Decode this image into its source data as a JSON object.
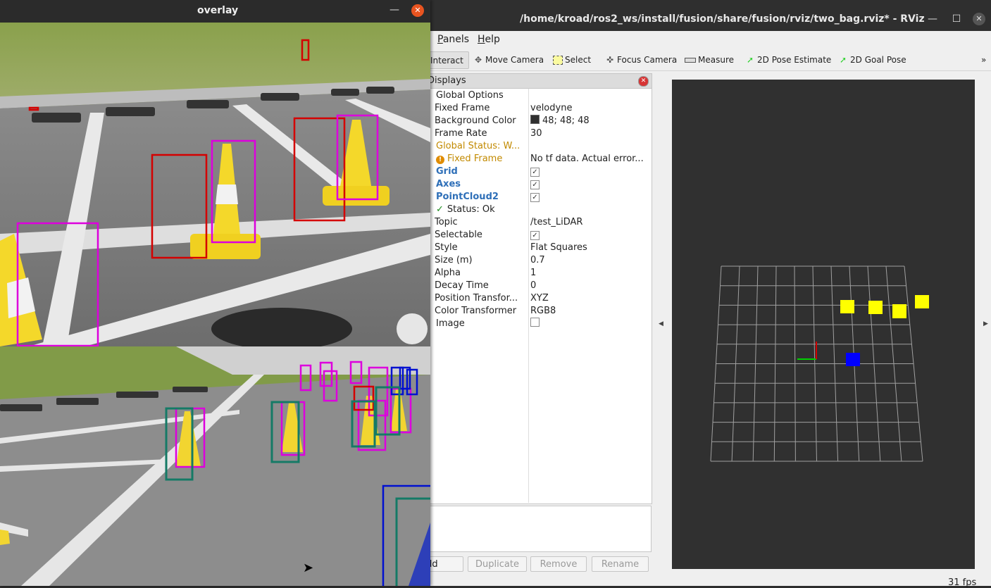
{
  "rviz": {
    "title": "/home/kroad/ros2_ws/install/fusion/share/fusion/rviz/two_bag.rviz* - RViz",
    "menu": [
      "Panels",
      "Help"
    ],
    "toolbar": {
      "interact": "Interact",
      "move_camera": "Move Camera",
      "select": "Select",
      "focus_camera": "Focus Camera",
      "measure": "Measure",
      "pose_estimate": "2D Pose Estimate",
      "goal_pose": "2D Goal Pose",
      "overflow": "»"
    },
    "displays": {
      "title": "Displays",
      "rows": [
        {
          "key": "Global Options",
          "value": ""
        },
        {
          "key": "Fixed Frame",
          "value": "velodyne"
        },
        {
          "key": "Background Color",
          "value": "48; 48; 48"
        },
        {
          "key": "Frame Rate",
          "value": "30"
        },
        {
          "key": "Global Status: W...",
          "value": ""
        },
        {
          "key": "Fixed Frame",
          "value": "No tf data.  Actual error..."
        },
        {
          "key": "Grid",
          "value": "✓"
        },
        {
          "key": "Axes",
          "value": "✓"
        },
        {
          "key": "PointCloud2",
          "value": "✓"
        },
        {
          "key": "Status: Ok",
          "value": ""
        },
        {
          "key": "Topic",
          "value": "/test_LiDAR"
        },
        {
          "key": "Selectable",
          "value": "✓"
        },
        {
          "key": "Style",
          "value": "Flat Squares"
        },
        {
          "key": "Size (m)",
          "value": "0.7"
        },
        {
          "key": "Alpha",
          "value": "1"
        },
        {
          "key": "Decay Time",
          "value": "0"
        },
        {
          "key": "Position Transfor...",
          "value": "XYZ"
        },
        {
          "key": "Color Transformer",
          "value": "RGB8"
        },
        {
          "key": "Image",
          "value": ""
        }
      ]
    },
    "buttons": {
      "add": "Add",
      "duplicate": "Duplicate",
      "remove": "Remove",
      "rename": "Rename"
    },
    "fps": "31 fps",
    "view": {
      "background": "#303030",
      "grid_color": "#a0a0a0",
      "point_colors": [
        "#ffff00",
        "#0000ff"
      ]
    }
  },
  "overlay": {
    "title": "overlay",
    "box_colors": {
      "red": "#d40000",
      "magenta": "#dd00dd",
      "blue": "#0010d0",
      "teal": "#157a66"
    }
  }
}
